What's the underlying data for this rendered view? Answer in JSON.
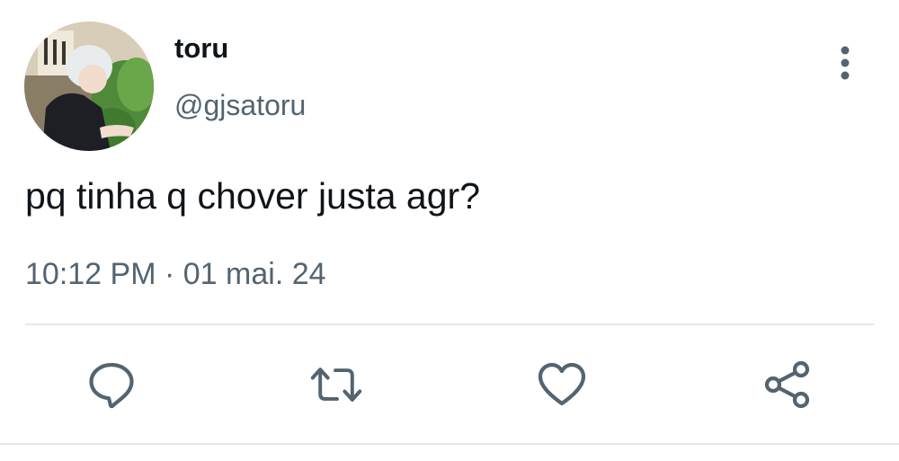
{
  "author": {
    "display_name": "toru",
    "handle": "@gjsatoru",
    "avatar_icon": "profile-photo"
  },
  "tweet": {
    "text": "pq tinha q chover justa agr?",
    "time": "10:12 PM",
    "separator": "·",
    "date": "01 mai. 24"
  },
  "actions": [
    {
      "icon": "reply-icon"
    },
    {
      "icon": "retweet-icon"
    },
    {
      "icon": "like-icon"
    },
    {
      "icon": "share-icon"
    }
  ],
  "colors": {
    "text_primary": "#0f1419",
    "text_secondary": "#536471",
    "icon": "#536471",
    "divider": "#e4e8eb"
  }
}
